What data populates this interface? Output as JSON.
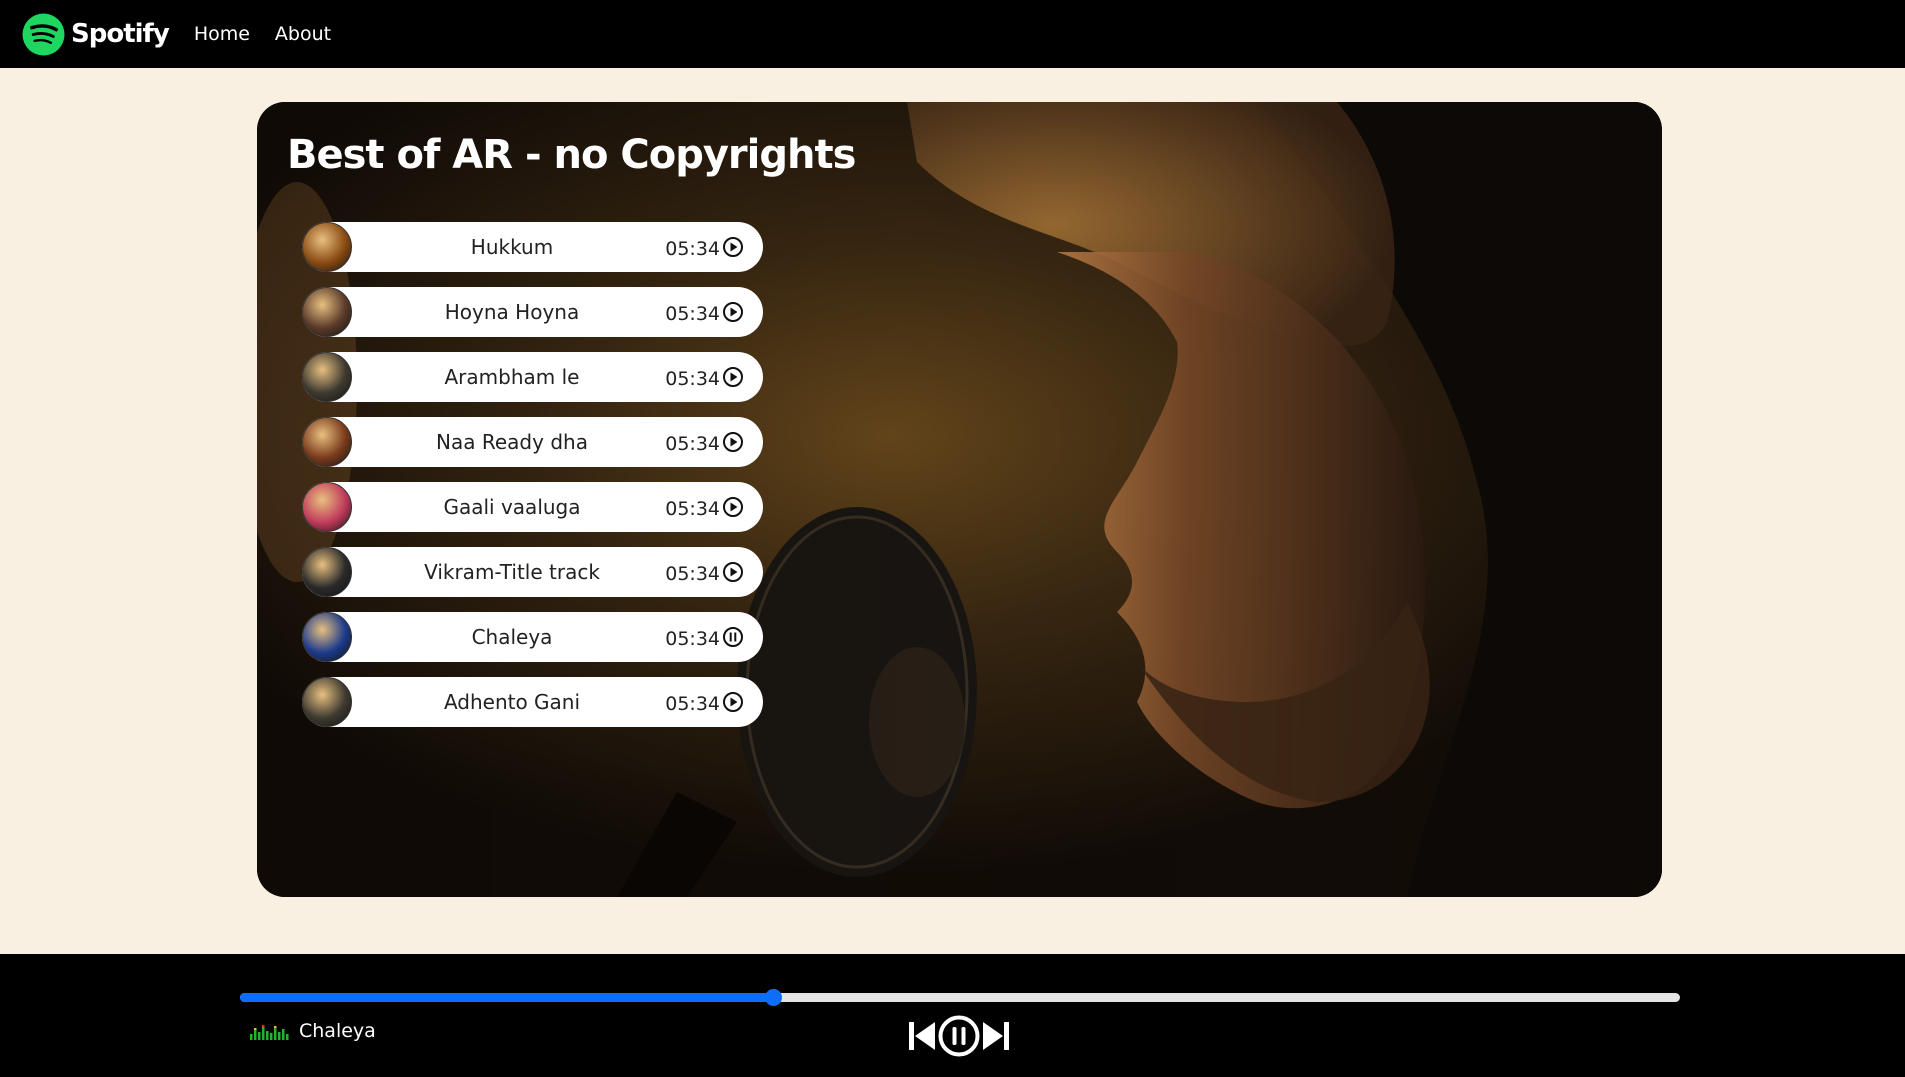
{
  "navbar": {
    "brand": "Spotify",
    "links": [
      "Home",
      "About"
    ],
    "brand_color": "#1ed760"
  },
  "playlist": {
    "title": "Best of AR - no Copyrights",
    "songs": [
      {
        "name": "Hukkum",
        "duration": "05:34",
        "icon": "play-circle-icon",
        "cover_color": "#8a4a12"
      },
      {
        "name": "Hoyna Hoyna",
        "duration": "05:34",
        "icon": "play-circle-icon",
        "cover_color": "#5a3a2a"
      },
      {
        "name": "Arambham le",
        "duration": "05:34",
        "icon": "play-circle-icon",
        "cover_color": "#3e3a30"
      },
      {
        "name": "Naa Ready dha",
        "duration": "05:34",
        "icon": "play-circle-icon",
        "cover_color": "#7a3a1c"
      },
      {
        "name": "Gaali vaaluga",
        "duration": "05:34",
        "icon": "play-circle-icon",
        "cover_color": "#c03a5a"
      },
      {
        "name": "Vikram-Title track",
        "duration": "05:34",
        "icon": "play-circle-icon",
        "cover_color": "#2a2a2a"
      },
      {
        "name": "Chaleya",
        "duration": "05:34",
        "icon": "pause-circle-icon",
        "cover_color": "#1c3a8a"
      },
      {
        "name": "Adhento Gani",
        "duration": "05:34",
        "icon": "play-circle-icon",
        "cover_color": "#3e3a30"
      }
    ]
  },
  "player": {
    "now_playing": "Chaleya",
    "progress_percent": 37,
    "progress_color": "#0d6efd",
    "icons": [
      "previous-icon",
      "pause-circle-icon",
      "next-icon"
    ]
  }
}
